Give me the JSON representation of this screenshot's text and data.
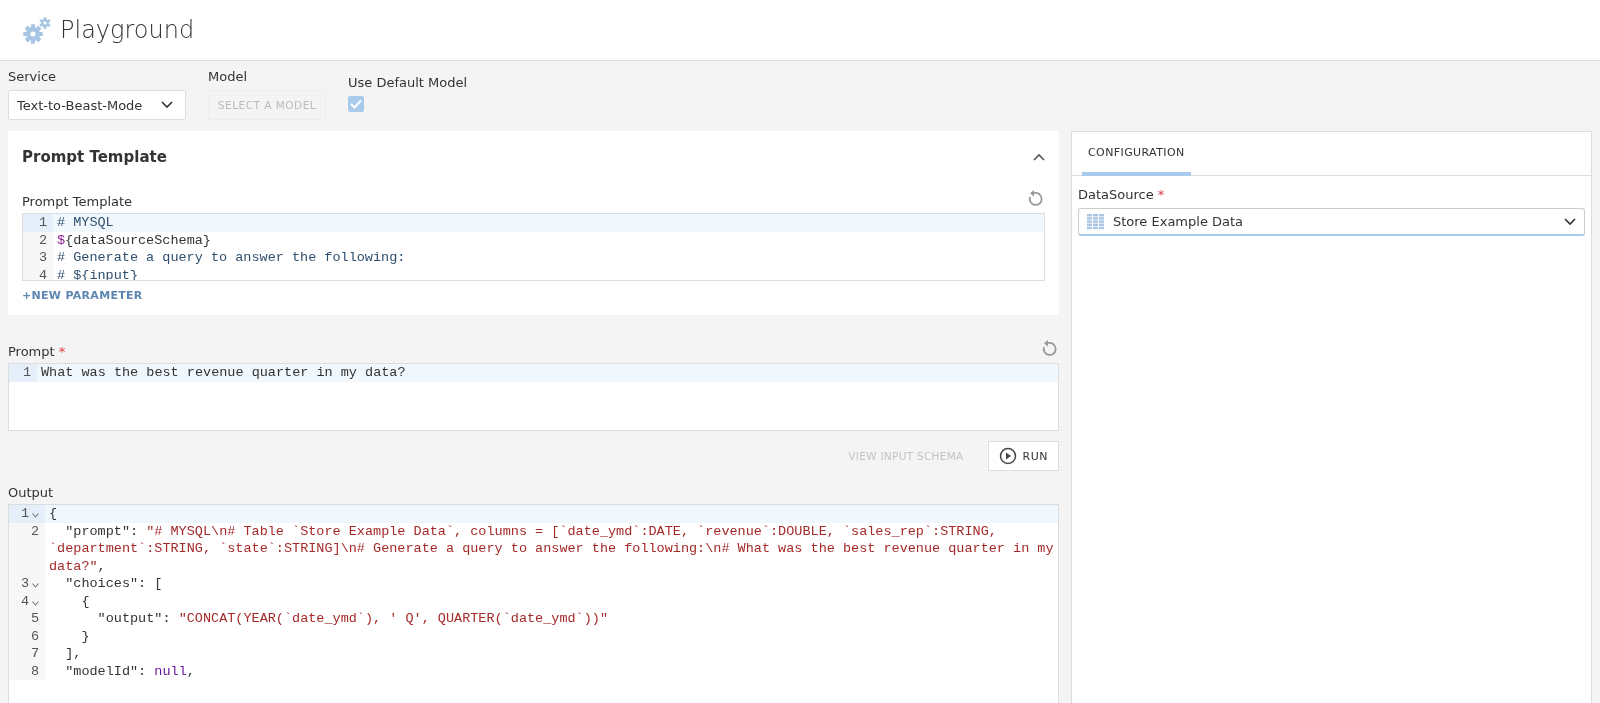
{
  "header": {
    "title": "Playground"
  },
  "toolbar": {
    "service": {
      "label": "Service",
      "value": "Text-to-Beast-Mode"
    },
    "model": {
      "label": "Model",
      "button": "SELECT A MODEL",
      "disabled": true
    },
    "use_default": {
      "label": "Use Default Model",
      "checked": true
    }
  },
  "prompt_template_card": {
    "title": "Prompt Template",
    "expanded": true,
    "field_label": "Prompt Template",
    "lines": [
      {
        "number": "1",
        "active": true,
        "fold": false,
        "segments": [
          {
            "kind": "comment",
            "text": "# MYSQL"
          }
        ]
      },
      {
        "number": "2",
        "active": false,
        "fold": false,
        "segments": [
          {
            "kind": "variable",
            "text": "$"
          },
          {
            "kind": "plain",
            "text": "{dataSourceSchema}"
          }
        ]
      },
      {
        "number": "3",
        "active": false,
        "fold": false,
        "segments": [
          {
            "kind": "comment",
            "text": "# Generate a query to answer the following:"
          }
        ]
      },
      {
        "number": "4",
        "active": false,
        "fold": false,
        "segments": [
          {
            "kind": "comment",
            "text": "# ${input}"
          }
        ]
      }
    ],
    "link": "+NEW PARAMETER"
  },
  "prompt": {
    "label": "Prompt",
    "required_mark": "*",
    "lines": [
      {
        "number": "1",
        "active": true,
        "fold": false,
        "segments": [
          {
            "kind": "plain",
            "text": "What was the best revenue quarter in my data?"
          }
        ]
      }
    ]
  },
  "actions": [
    {
      "kind": "link",
      "label": "VIEW INPUT SCHEMA",
      "disabled": true
    },
    {
      "kind": "run",
      "label": "RUN",
      "disabled": false
    }
  ],
  "output": {
    "label": "Output",
    "lines": [
      {
        "number": "1",
        "active": true,
        "fold": true,
        "segments": [
          {
            "kind": "plain",
            "text": "{"
          }
        ]
      },
      {
        "number": "2",
        "active": false,
        "fold": false,
        "segments": [
          {
            "kind": "plain",
            "text": "  \"prompt\": "
          },
          {
            "kind": "string",
            "text": "\"# MYSQL\\n# Table `Store Example Data`, columns = [`date_ymd`:DATE, `revenue`:DOUBLE, `sales_rep`:STRING, `department`:STRING, `state`:STRING]\\n# Generate a query to answer the following:\\n# What was the best revenue quarter in my data?\""
          },
          {
            "kind": "plain",
            "text": ","
          }
        ]
      },
      {
        "number": "3",
        "active": false,
        "fold": true,
        "segments": [
          {
            "kind": "plain",
            "text": "  \"choices\": ["
          }
        ]
      },
      {
        "number": "4",
        "active": false,
        "fold": true,
        "segments": [
          {
            "kind": "plain",
            "text": "    {"
          }
        ]
      },
      {
        "number": "5",
        "active": false,
        "fold": false,
        "segments": [
          {
            "kind": "plain",
            "text": "      \"output\": "
          },
          {
            "kind": "string",
            "text": "\"CONCAT(YEAR(`date_ymd`), ' Q', QUARTER(`date_ymd`))\""
          }
        ]
      },
      {
        "number": "6",
        "active": false,
        "fold": false,
        "segments": [
          {
            "kind": "plain",
            "text": "    }"
          }
        ]
      },
      {
        "number": "7",
        "active": false,
        "fold": false,
        "segments": [
          {
            "kind": "plain",
            "text": "  ],"
          }
        ]
      },
      {
        "number": "8",
        "active": false,
        "fold": false,
        "segments": [
          {
            "kind": "plain",
            "text": "  \"modelId\": "
          },
          {
            "kind": "keyword",
            "text": "null"
          },
          {
            "kind": "plain",
            "text": ","
          }
        ]
      }
    ]
  },
  "configuration": {
    "tabs": [
      {
        "label": "CONFIGURATION",
        "selected": true
      }
    ],
    "datasource": {
      "label": "DataSource",
      "required_mark": "*",
      "value": "Store Example Data"
    }
  }
}
